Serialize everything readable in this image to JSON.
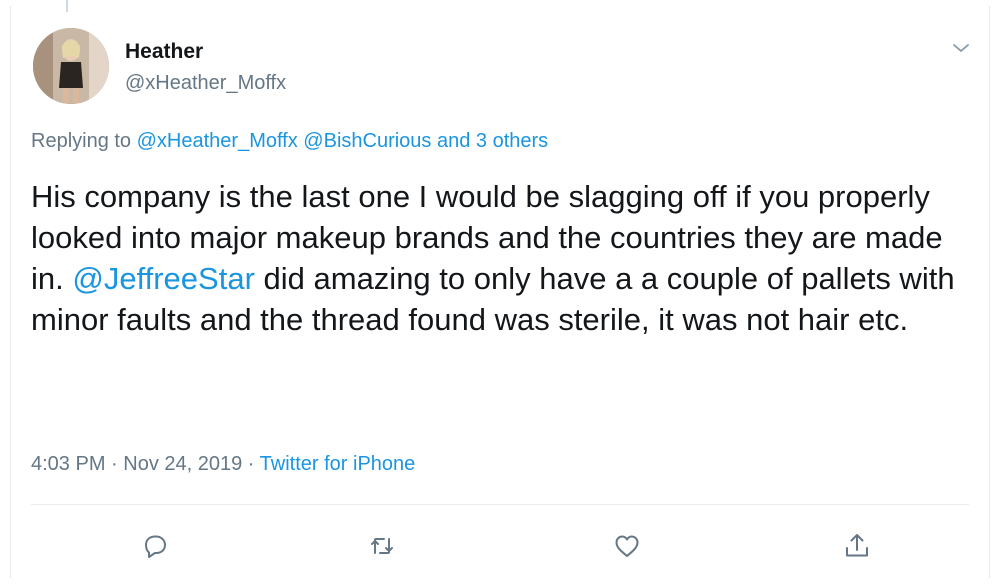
{
  "user": {
    "name": "Heather",
    "handle": "@xHeather_Moffx"
  },
  "reply": {
    "prefix": "Replying to ",
    "mentions": "@xHeather_Moffx @BishCurious and 3 others"
  },
  "tweet": {
    "text_before": "His company is the last one I would be slagging off if you properly looked into major makeup brands and the countries they are made in. ",
    "mention": "@JeffreeStar",
    "text_after": " did amazing to only have a a couple of pallets with minor faults and the thread found was sterile, it was not hair etc."
  },
  "meta": {
    "time_date": "4:03 PM · Nov 24, 2019 · ",
    "source": "Twitter for iPhone"
  },
  "icons": {
    "reply": "reply-icon",
    "retweet": "retweet-icon",
    "like": "heart-icon",
    "share": "share-icon",
    "more": "chevron-down-icon"
  },
  "colors": {
    "link": "#1b95e0",
    "secondary": "#657786",
    "text": "#14171a"
  }
}
